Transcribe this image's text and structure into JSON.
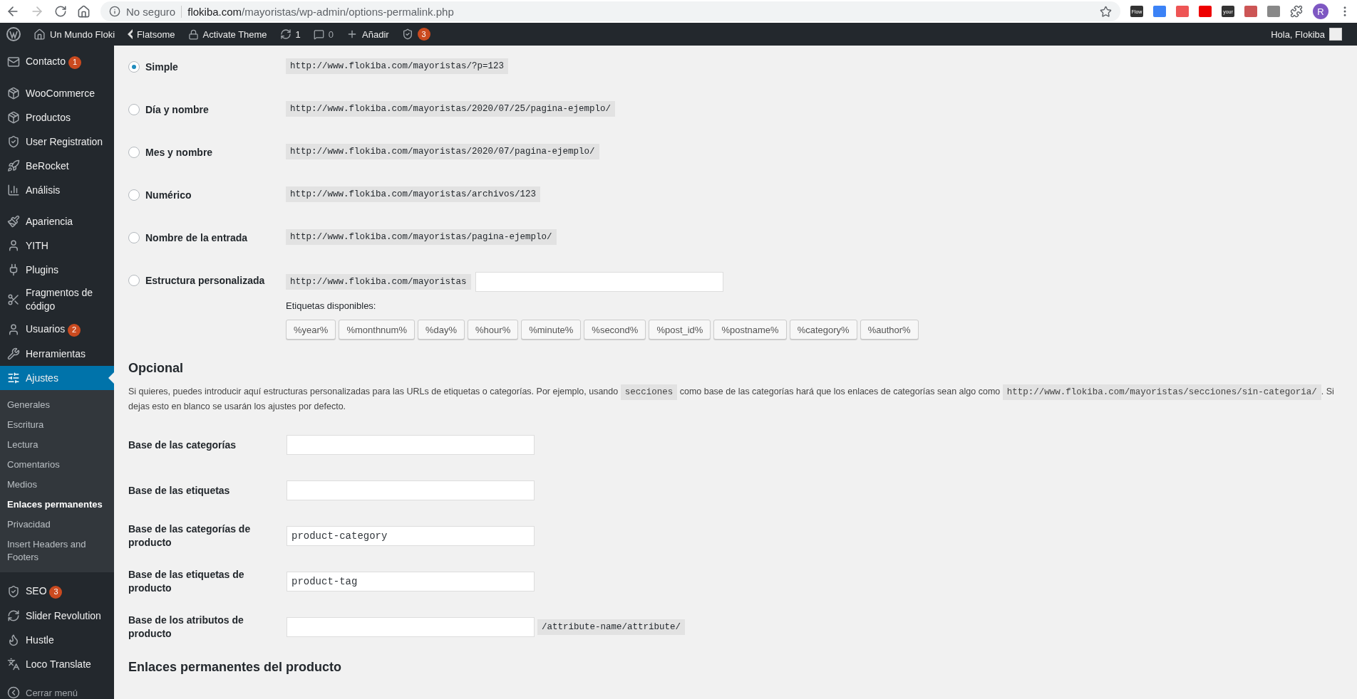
{
  "browser": {
    "security": "No seguro",
    "url_host": "flokiba.com",
    "url_path": "/mayoristas/wp-admin/options-permalink.php",
    "extensions": [
      {
        "label": "Flow"
      },
      {
        "label": "your"
      }
    ],
    "profile": "R"
  },
  "admin_bar": {
    "site": "Un Mundo Floki",
    "theme": "Flatsome",
    "activate": "Activate Theme",
    "updates": "1",
    "comments": "0",
    "add": "Añadir",
    "seo_badge": "3",
    "greeting": "Hola, Flokiba"
  },
  "sidebar": {
    "groups": [
      [
        {
          "label": "Contacto",
          "badge": "1",
          "selected": false
        }
      ],
      [
        {
          "label": "WooCommerce",
          "selected": false
        },
        {
          "label": "Productos",
          "selected": false
        },
        {
          "label": "User Registration",
          "selected": false
        },
        {
          "label": "BeRocket",
          "selected": false
        },
        {
          "label": "Análisis",
          "selected": false
        }
      ],
      [
        {
          "label": "Apariencia",
          "selected": false
        },
        {
          "label": "YITH",
          "selected": false
        },
        {
          "label": "Plugins",
          "selected": false
        },
        {
          "label": "Fragmentos de código",
          "selected": false
        },
        {
          "label": "Usuarios",
          "badge": "2",
          "selected": false
        },
        {
          "label": "Herramientas",
          "selected": false
        },
        {
          "label": "Ajustes",
          "selected": true,
          "children": [
            {
              "label": "Generales",
              "selected": false
            },
            {
              "label": "Escritura",
              "selected": false
            },
            {
              "label": "Lectura",
              "selected": false
            },
            {
              "label": "Comentarios",
              "selected": false
            },
            {
              "label": "Medios",
              "selected": false
            },
            {
              "label": "Enlaces permanentes",
              "selected": true
            },
            {
              "label": "Privacidad",
              "selected": false
            },
            {
              "label": "Insert Headers and Footers",
              "selected": false
            }
          ]
        }
      ],
      [
        {
          "label": "SEO",
          "badge": "3",
          "selected": false
        },
        {
          "label": "Slider Revolution",
          "selected": false
        },
        {
          "label": "Hustle",
          "selected": false
        },
        {
          "label": "Loco Translate",
          "selected": false
        }
      ]
    ],
    "collapse": "Cerrar menú"
  },
  "permalink_options": [
    {
      "kind": "preset",
      "label": "Simple",
      "example": "http://www.flokiba.com/mayoristas/?p=123",
      "selected": true
    },
    {
      "kind": "preset",
      "label": "Día y nombre",
      "example": "http://www.flokiba.com/mayoristas/2020/07/25/pagina-ejemplo/",
      "selected": false
    },
    {
      "kind": "preset",
      "label": "Mes y nombre",
      "example": "http://www.flokiba.com/mayoristas/2020/07/pagina-ejemplo/",
      "selected": false
    },
    {
      "kind": "preset",
      "label": "Numérico",
      "example": "http://www.flokiba.com/mayoristas/archivos/123",
      "selected": false
    },
    {
      "kind": "preset",
      "label": "Nombre de la entrada",
      "example": "http://www.flokiba.com/mayoristas/pagina-ejemplo/",
      "selected": false
    },
    {
      "kind": "custom",
      "label": "Estructura personalizada",
      "example": "http://www.flokiba.com/mayoristas",
      "selected": false
    }
  ],
  "tags_label": "Etiquetas disponibles:",
  "tags": [
    "%year%",
    "%monthnum%",
    "%day%",
    "%hour%",
    "%minute%",
    "%second%",
    "%post_id%",
    "%postname%",
    "%category%",
    "%author%"
  ],
  "optional": {
    "title": "Opcional",
    "description": [
      {
        "kind": "text",
        "text": "Si quieres, puedes introducir aquí estructuras personalizadas para las URLs de etiquetas o categorías. Por ejemplo, usando "
      },
      {
        "kind": "code",
        "text": "secciones"
      },
      {
        "kind": "text",
        "text": " como base de las categorías hará que los enlaces de categorías sean algo como "
      },
      {
        "kind": "code",
        "text": "http://www.flokiba.com/mayoristas/secciones/sin-categoria/"
      },
      {
        "kind": "text",
        "text": ". Si dejas esto en blanco se usarán los ajustes por defecto."
      }
    ]
  },
  "fields": [
    {
      "label": "Base de las categorías"
    },
    {
      "label": "Base de las etiquetas"
    },
    {
      "label": "Base de las categorías de producto",
      "value": "product-category"
    },
    {
      "label": "Base de las etiquetas de producto",
      "value": "product-tag"
    },
    {
      "label": "Base de los atributos de producto",
      "suffix": "/attribute-name/attribute/"
    }
  ],
  "product_section_title": "Enlaces permanentes del producto"
}
